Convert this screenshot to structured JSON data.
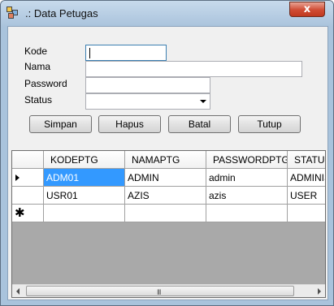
{
  "window": {
    "title": ".: Data Petugas",
    "close_glyph": "x"
  },
  "form": {
    "kode_label": "Kode",
    "nama_label": "Nama",
    "password_label": "Password",
    "status_label": "Status",
    "kode_value": "",
    "nama_value": "",
    "password_value": "",
    "status_value": ""
  },
  "buttons": {
    "simpan": "Simpan",
    "hapus": "Hapus",
    "batal": "Batal",
    "tutup": "Tutup"
  },
  "grid": {
    "columns": [
      "KODEPTG",
      "NAMAPTG",
      "PASSWORDPTG",
      "STATUS"
    ],
    "rows": [
      [
        "ADM01",
        "ADMIN",
        "admin",
        "ADMINIS"
      ],
      [
        "USR01",
        "AZIS",
        "azis",
        "USER"
      ]
    ],
    "new_row_glyph": "✱",
    "scroll_grip": "III"
  },
  "icons": {
    "app": "app-window-icon",
    "close": "close-icon",
    "dropdown": "chevron-down-icon",
    "current_row": "row-pointer-icon",
    "new_row": "new-row-star-icon",
    "scroll_left": "scroll-left-icon",
    "scroll_right": "scroll-right-icon"
  }
}
